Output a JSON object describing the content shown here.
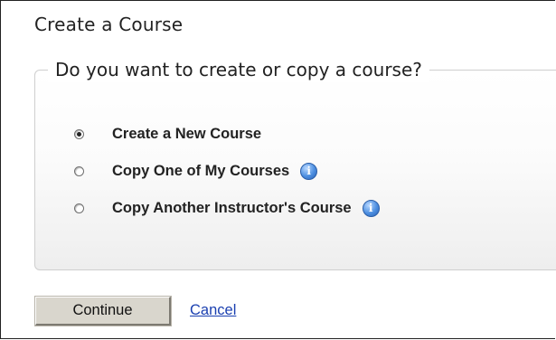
{
  "page": {
    "title": "Create a Course"
  },
  "group": {
    "legend": "Do you want to create or copy a course?",
    "options": [
      {
        "label": "Create a New Course",
        "selected": true,
        "has_info": false
      },
      {
        "label": "Copy One of My Courses",
        "selected": false,
        "has_info": true,
        "info_icon": "info-icon"
      },
      {
        "label": "Copy Another Instructor's Course",
        "selected": false,
        "has_info": true,
        "info_icon": "info-icon"
      }
    ],
    "info_glyph": "i"
  },
  "actions": {
    "continue_label": "Continue",
    "cancel_label": "Cancel"
  },
  "colors": {
    "link": "#1a3fb0",
    "button_face": "#d9d6cd",
    "info_icon": "#4c8ee0"
  }
}
